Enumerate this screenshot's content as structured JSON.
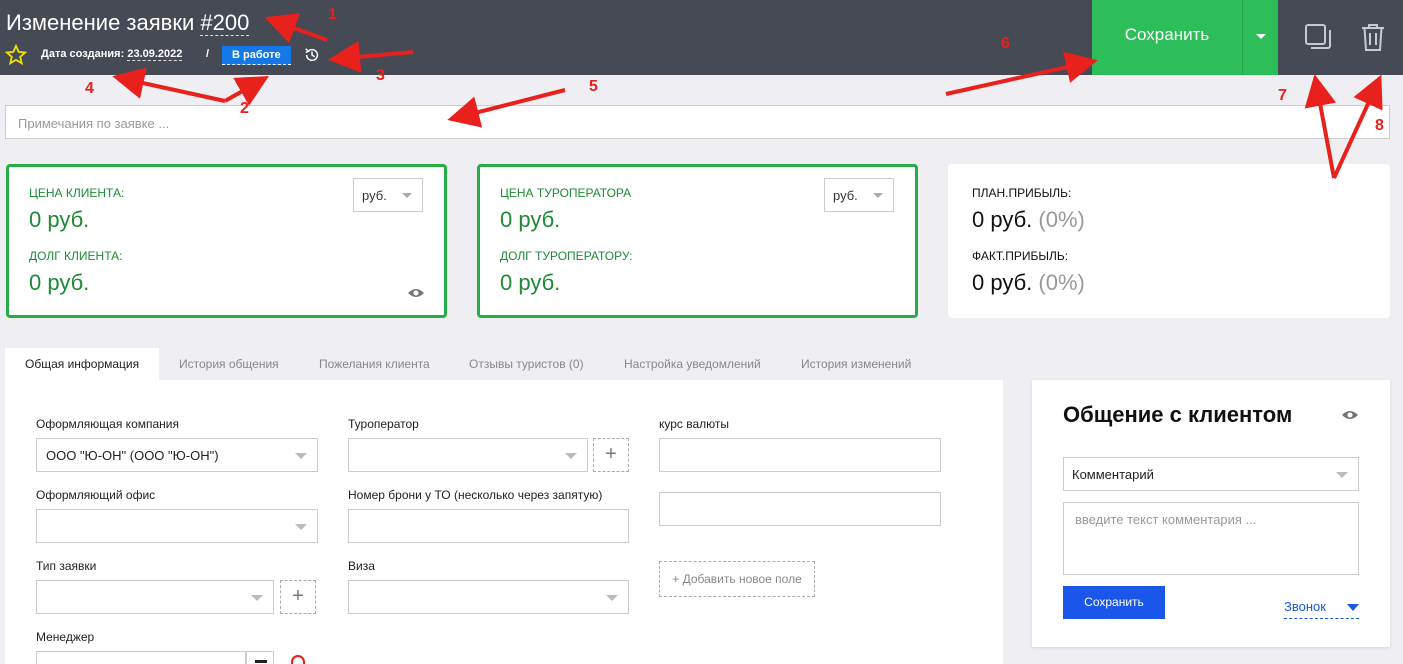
{
  "header": {
    "title_prefix": "Изменение заявки ",
    "title_number": "#200",
    "created_label": "Дата создания:",
    "created_date": "23.09.2022",
    "separator": "/",
    "status": "В работе",
    "save_label": "Сохранить",
    "icons": [
      "star-icon",
      "history-icon",
      "copy-icon",
      "trash-icon"
    ]
  },
  "annotations": [
    "1",
    "2",
    "3",
    "4",
    "5",
    "6",
    "7",
    "8"
  ],
  "notes": {
    "placeholder": "Примечания по заявке ..."
  },
  "client_card": {
    "price_label": "ЦЕНА КЛИЕНТА:",
    "price_value": "0 руб.",
    "debt_label": "ДОЛГ КЛИЕНТА:",
    "debt_value": "0 руб.",
    "currency": "руб."
  },
  "operator_card": {
    "price_label": "ЦЕНА ТУРОПЕРАТОРА",
    "price_value": "0 руб.",
    "debt_label": "ДОЛГ ТУРОПЕРАТОРУ:",
    "debt_value": "0 руб.",
    "currency": "руб."
  },
  "profit_card": {
    "plan_label": "ПЛАН.ПРИБЫЛЬ:",
    "plan_value": "0 руб.",
    "plan_pct": "(0%)",
    "fact_label": "ФАКТ.ПРИБЫЛЬ:",
    "fact_value": "0 руб.",
    "fact_pct": "(0%)"
  },
  "tabs": [
    "Общая информация",
    "История общения",
    "Пожелания клиента",
    "Отзывы туристов (0)",
    "Настройка уведомлений",
    "История изменений"
  ],
  "form": {
    "company_label": "Оформляющая компания",
    "company_value": "ООО \"Ю-ОН\" (ООО \"Ю-ОН\")",
    "office_label": "Оформляющий офис",
    "type_label": "Тип заявки",
    "manager_label": "Менеджер",
    "operator_label": "Туроператор",
    "booking_label": "Номер брони у ТО (несколько через запятую)",
    "visa_label": "Виза",
    "rate_label": "курс валюты",
    "add_field": "+ Добавить новое поле"
  },
  "side": {
    "title": "Общение с клиентом",
    "type": "Комментарий",
    "placeholder": "введите текст комментария ...",
    "save": "Сохранить",
    "call": "Звонок"
  },
  "colors": {
    "header_bg": "#454a55",
    "accent_green": "#2dbe5a",
    "status_blue": "#1478e6",
    "annotation_red": "#e8211c"
  }
}
